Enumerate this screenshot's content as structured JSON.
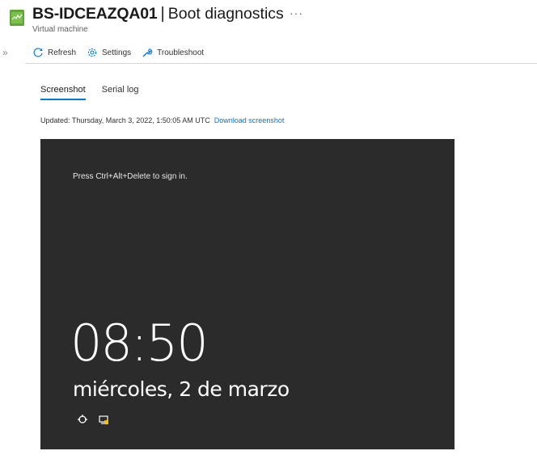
{
  "header": {
    "resource_name": "BS-IDCEAZQA01",
    "separator": "|",
    "page_title": "Boot diagnostics",
    "more_label": "···",
    "subtitle": "Virtual machine",
    "icon": "virtual-machine-icon"
  },
  "sidebar": {
    "expand_label": "»"
  },
  "toolbar": {
    "refresh_label": "Refresh",
    "settings_label": "Settings",
    "troubleshoot_label": "Troubleshoot"
  },
  "tabs": [
    {
      "label": "Screenshot",
      "active": true
    },
    {
      "label": "Serial log",
      "active": false
    }
  ],
  "status": {
    "updated_text": "Updated: Thursday, March 3, 2022, 1:50:05 AM UTC",
    "download_link": "Download screenshot"
  },
  "screenshot": {
    "hint": "Press Ctrl+Alt+Delete to sign in.",
    "time": "08:50",
    "date": "miércoles, 2 de marzo",
    "icons": [
      "accessibility-icon",
      "network-icon"
    ]
  },
  "colors": {
    "accent": "#0078d4",
    "screen_bg": "#2b2b2b",
    "vm_icon": "#5ea53a"
  }
}
